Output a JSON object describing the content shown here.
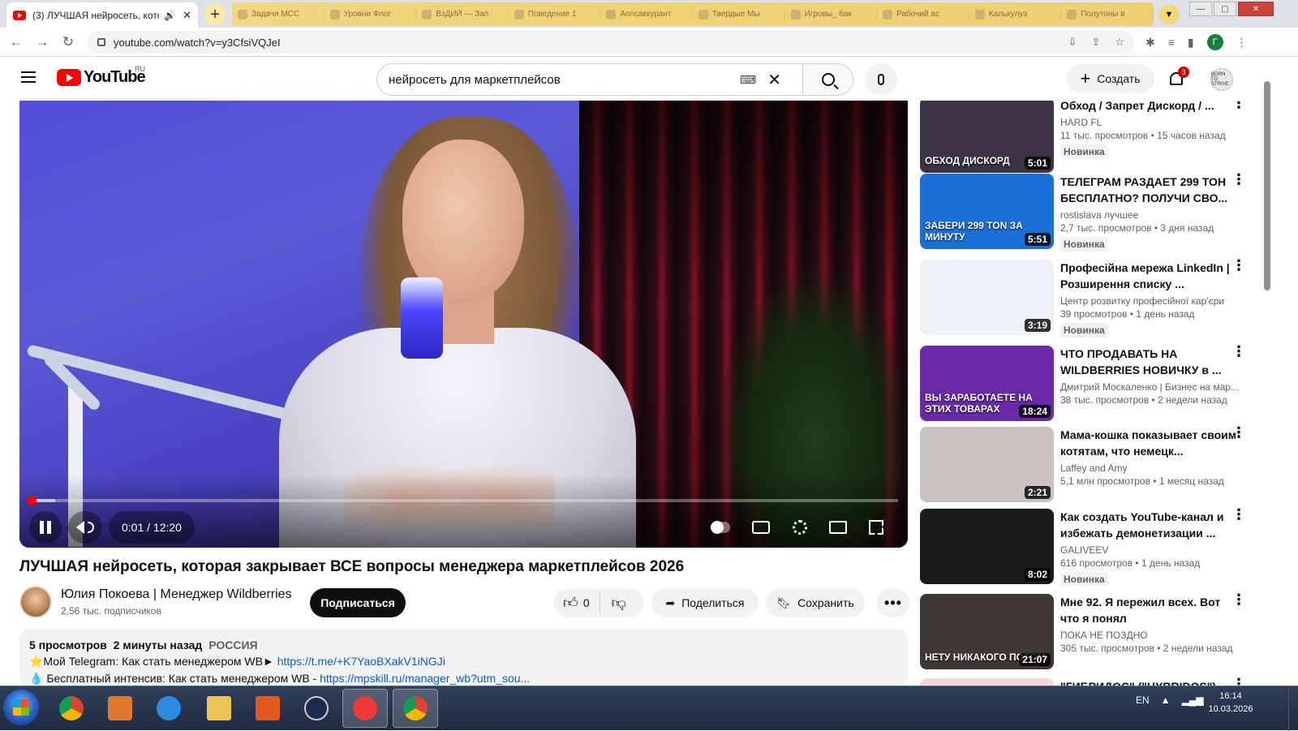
{
  "browser": {
    "active_tab_title": "(3) ЛУЧШАЯ нейросеть, кото",
    "inactive_tabs": [
      "Задачи МСС",
      "Уровни Флог",
      "ВзДИЙ — Зап",
      "Поведение 1",
      "Аппсаккурант",
      "Твердые Мы",
      "Игровы_ бак",
      "Рабочий ас",
      "Калькулуэ",
      "Полутоны в"
    ],
    "url": "youtube.com/watch?v=y3CfsiVQJeI",
    "profile_initial": "Г"
  },
  "header": {
    "logo_text": "YouTube",
    "logo_country": "RU",
    "search_value": "нейросеть для маркетплейсов",
    "create_label": "Создать",
    "notifications_count": "3",
    "avatar_text": "BORN TO STRIVE"
  },
  "player": {
    "time_display": "0:01 / 12:20",
    "progress_fraction": 0.001,
    "buffer_fraction": 0.03
  },
  "video": {
    "title": "ЛУЧШАЯ нейросеть, которая закрывает ВСЕ вопросы менеджера маркетплейсов 2026",
    "channel_name": "Юлия Покоева | Менеджер Wildberries",
    "subscribers": "2,56 тыс. подписчиков",
    "subscribe_label": "Подписаться",
    "likes": "0",
    "share_label": "Поделиться",
    "save_label": "Сохранить",
    "more_label": "•••",
    "views": "5 просмотров",
    "published": "2 минуты назад",
    "country": "РОССИЯ",
    "desc_line1_text": "⭐Мой Telegram: Как стать менеджером WB►",
    "desc_line1_link": "https://t.me/+K7YaoBXakV1iNGJi",
    "desc_line2_text": "💧 Бесплатный интенсив: Как стать менеджером WB -",
    "desc_line2_link": "https://mpskill.ru/manager_wb?utm_sou..."
  },
  "sidebar": {
    "items": [
      {
        "title": "Обход / Запрет Дискорд / ...",
        "channel": "HARD FL",
        "stats": "11 тыс. просмотров • 15 часов назад",
        "badge": "Новинка",
        "duration": "5:01",
        "thumb_caption": "ОБХОД ДИСКОРД",
        "thumb_bg": "#3a3446"
      },
      {
        "title": "ТЕЛЕГРАМ РАЗДАЕТ 299 ТОН БЕСПЛАТНО? ПОЛУЧИ СВО...",
        "channel": "rostislava лучшее",
        "stats": "2,7 тыс. просмотров • 3 дня назад",
        "badge": "Новинка",
        "duration": "5:51",
        "thumb_caption": "ЗАБЕРИ 299 TON ЗА МИНУТУ",
        "thumb_bg": "#1d6fd8"
      },
      {
        "title": "Професійна мережа LinkedIn | Розширення списку ...",
        "channel": "Центр розвитку професійної кар'єри",
        "stats": "39 просмотров • 1 день назад",
        "badge": "Новинка",
        "duration": "3:19",
        "thumb_caption": "",
        "thumb_bg": "#eef1f6"
      },
      {
        "title": "ЧТО ПРОДАВАТЬ НА WILDBERRIES НОВИЧКУ в ...",
        "channel": "Дмитрий Москаленко | Бизнес на мар...",
        "stats": "38 тыс. просмотров • 2 недели назад",
        "badge": "",
        "duration": "18:24",
        "thumb_caption": "ВЫ ЗАРАБОТАЕТЕ НА ЭТИХ ТОВАРАХ",
        "thumb_bg": "#6a2aa8"
      },
      {
        "title": "Мама-кошка показывает своим котятам, что немецк...",
        "channel": "Laffey and Amy",
        "stats": "5,1 млн просмотров • 1 месяц назад",
        "badge": "",
        "duration": "2:21",
        "thumb_caption": "",
        "thumb_bg": "#c8c4c0"
      },
      {
        "title": "Как создать YouTube-канал и избежать демонетизации ...",
        "channel": "GALIVEEV",
        "stats": "616 просмотров • 1 день назад",
        "badge": "Новинка",
        "duration": "8:02",
        "thumb_caption": "",
        "thumb_bg": "#1b1b1b"
      },
      {
        "title": "Мне 92. Я пережил всех. Вот что я понял",
        "channel": "ПОКА НЕ ПОЗДНО",
        "stats": "305 тыс. просмотров • 2 недели назад",
        "badge": "",
        "duration": "21:07",
        "thumb_caption": "НЕТУ НИКАКОГО ПОТОМ",
        "thumb_bg": "#3d3a36"
      },
      {
        "title": "\"ГИБРИДОС\" (\"HYBRIDOS\")...",
        "channel": "",
        "stats": "",
        "badge": "",
        "duration": "",
        "thumb_caption": "",
        "thumb_bg": "#f4d9d9"
      }
    ]
  },
  "taskbar": {
    "language": "EN",
    "time": "16:14",
    "date": "10.03.2026"
  },
  "colors": {
    "youtube_red": "#ff0000",
    "link_blue": "#065fd4",
    "tab_strip_yellow": "#f1d270"
  }
}
